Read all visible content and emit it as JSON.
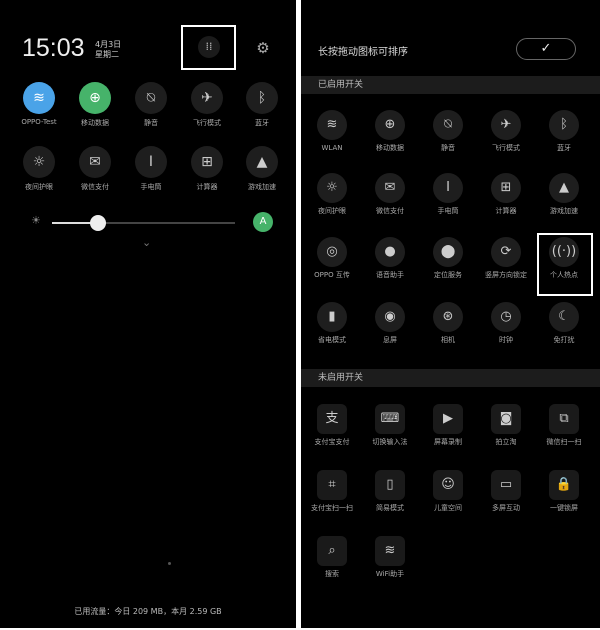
{
  "left_panel": {
    "time": "15:03",
    "date_line1": "4月3日",
    "date_line2": "星期二",
    "edit_icon": "grid-icon",
    "settings_icon": "gear-icon",
    "quick_settings": [
      {
        "label": "OPPO-Test",
        "icon": "wifi-icon",
        "glyph": "≋",
        "active": true
      },
      {
        "label": "移动数据",
        "icon": "globe-icon",
        "glyph": "⊕",
        "active": true
      },
      {
        "label": "静音",
        "icon": "mute-icon",
        "glyph": "⍉",
        "active": false
      },
      {
        "label": "飞行模式",
        "icon": "airplane-icon",
        "glyph": "✈",
        "active": false
      },
      {
        "label": "蓝牙",
        "icon": "bluetooth-icon",
        "glyph": "ᛒ",
        "active": false
      },
      {
        "label": "夜间护眼",
        "icon": "eye-icon",
        "glyph": "☼",
        "active": false
      },
      {
        "label": "微信支付",
        "icon": "wechat-pay-icon",
        "glyph": "✉",
        "active": false
      },
      {
        "label": "手电筒",
        "icon": "flashlight-icon",
        "glyph": "Ⅰ",
        "active": false
      },
      {
        "label": "计算器",
        "icon": "calculator-icon",
        "glyph": "⊞",
        "active": false
      },
      {
        "label": "游戏加速",
        "icon": "rocket-icon",
        "glyph": "▲",
        "active": false
      }
    ],
    "brightness_level": 0.25,
    "auto_brightness_label": "A",
    "footer": "已用流量：今日 209 MB，本月 2.59 GB"
  },
  "right_panel": {
    "title": "长按拖动图标可排序",
    "confirm_glyph": "✓",
    "enabled_section_label": "已启用开关",
    "enabled_tiles": [
      {
        "label": "WLAN",
        "icon": "wifi-icon",
        "glyph": "≋"
      },
      {
        "label": "移动数据",
        "icon": "globe-icon",
        "glyph": "⊕"
      },
      {
        "label": "静音",
        "icon": "mute-icon",
        "glyph": "⍉"
      },
      {
        "label": "飞行模式",
        "icon": "airplane-icon",
        "glyph": "✈"
      },
      {
        "label": "蓝牙",
        "icon": "bluetooth-icon",
        "glyph": "ᛒ"
      },
      {
        "label": "夜间护眼",
        "icon": "eye-icon",
        "glyph": "☼"
      },
      {
        "label": "微信支付",
        "icon": "wechat-pay-icon",
        "glyph": "✉"
      },
      {
        "label": "手电筒",
        "icon": "flashlight-icon",
        "glyph": "Ⅰ"
      },
      {
        "label": "计算器",
        "icon": "calculator-icon",
        "glyph": "⊞"
      },
      {
        "label": "游戏加速",
        "icon": "rocket-icon",
        "glyph": "▲"
      },
      {
        "label": "OPPO 互传",
        "icon": "share-icon",
        "glyph": "◎"
      },
      {
        "label": "语音助手",
        "icon": "mic-icon",
        "glyph": "●"
      },
      {
        "label": "定位服务",
        "icon": "location-icon",
        "glyph": "⬤"
      },
      {
        "label": "竖屏方向锁定",
        "icon": "rotation-lock-icon",
        "glyph": "⟳"
      },
      {
        "label": "个人热点",
        "icon": "hotspot-icon",
        "glyph": "((·))"
      },
      {
        "label": "省电模式",
        "icon": "battery-icon",
        "glyph": "▮"
      },
      {
        "label": "息屏",
        "icon": "screen-off-icon",
        "glyph": "◉"
      },
      {
        "label": "相机",
        "icon": "camera-icon",
        "glyph": "⊛"
      },
      {
        "label": "时钟",
        "icon": "clock-icon",
        "glyph": "◷"
      },
      {
        "label": "免打扰",
        "icon": "moon-icon",
        "glyph": "☾"
      }
    ],
    "disabled_section_label": "未启用开关",
    "disabled_tiles": [
      {
        "label": "支付宝支付",
        "icon": "alipay-icon",
        "glyph": "支"
      },
      {
        "label": "切换输入法",
        "icon": "keyboard-icon",
        "glyph": "⌨"
      },
      {
        "label": "屏幕录制",
        "icon": "screen-record-icon",
        "glyph": "▶"
      },
      {
        "label": "拍立淘",
        "icon": "camera-icon",
        "glyph": "◙"
      },
      {
        "label": "微信扫一扫",
        "icon": "scan-icon",
        "glyph": "⧉"
      },
      {
        "label": "支付宝扫一扫",
        "icon": "scan-icon",
        "glyph": "⌗"
      },
      {
        "label": "简易模式",
        "icon": "simple-mode-icon",
        "glyph": "▯"
      },
      {
        "label": "儿童空间",
        "icon": "child-icon",
        "glyph": "☺"
      },
      {
        "label": "多屏互动",
        "icon": "cast-icon",
        "glyph": "▭"
      },
      {
        "label": "一键锁屏",
        "icon": "lock-icon",
        "glyph": "🔒"
      },
      {
        "label": "搜索",
        "icon": "search-icon",
        "glyph": "⌕"
      },
      {
        "label": "WiFi助手",
        "icon": "wifi-icon",
        "glyph": "≋"
      }
    ]
  }
}
